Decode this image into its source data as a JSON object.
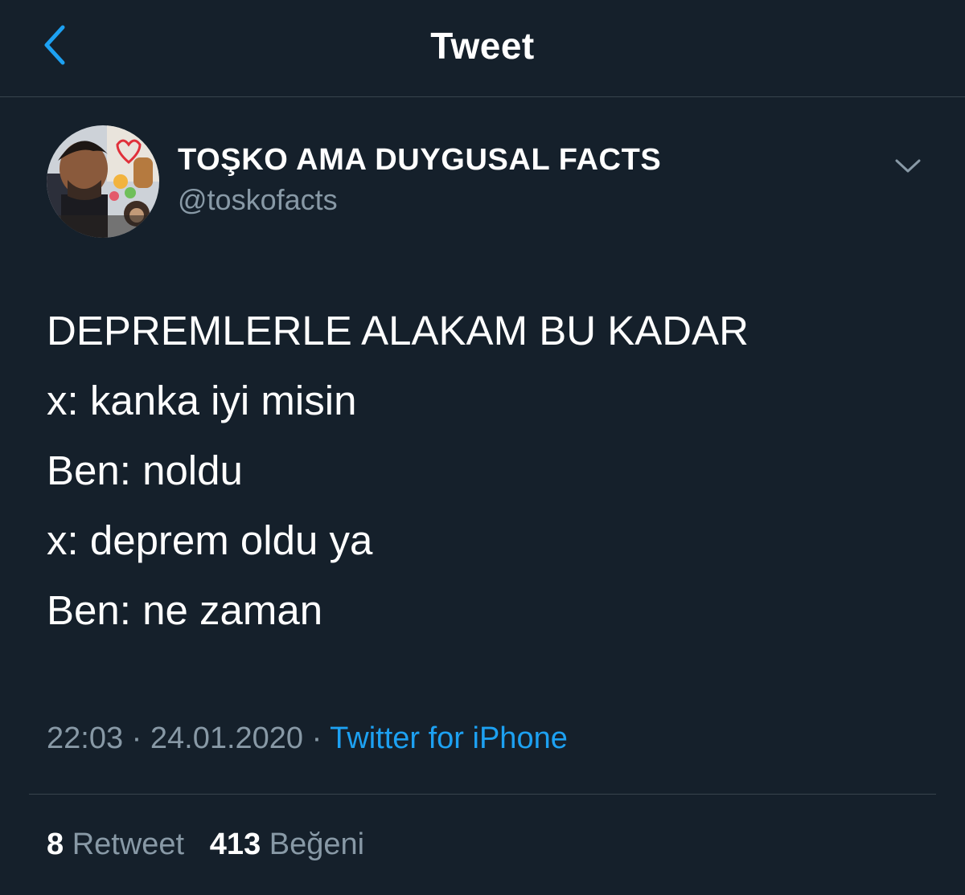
{
  "header": {
    "title": "Tweet",
    "back_icon": "chevron-left-icon"
  },
  "author": {
    "display_name": "TOŞKO AMA DUYGUSAL FACTS",
    "handle": "@toskofacts",
    "more_icon": "chevron-down-icon"
  },
  "tweet": {
    "lines": [
      "DEPREMLERLE ALAKAM BU KADAR",
      "x: kanka iyi misin",
      "Ben: noldu",
      "x: deprem oldu ya",
      "Ben: ne zaman"
    ],
    "time": "22:03",
    "separator": "·",
    "date": "24.01.2020",
    "source": "Twitter for iPhone"
  },
  "stats": {
    "retweets_count": "8",
    "retweets_label": "Retweet",
    "likes_count": "413",
    "likes_label": "Beğeni"
  },
  "colors": {
    "background": "#15202b",
    "accent": "#1da1f2",
    "secondary_text": "#8899a6",
    "divider": "#38444d"
  }
}
